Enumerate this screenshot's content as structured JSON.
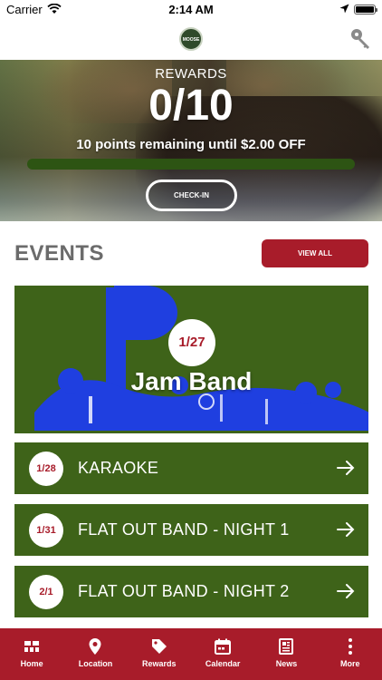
{
  "status_bar": {
    "carrier": "Carrier",
    "time": "2:14 AM"
  },
  "header": {
    "logo_text": "MOOSE",
    "key_icon": "key-icon"
  },
  "rewards": {
    "label": "REWARDS",
    "count": "0/10",
    "remaining_text": "10 points remaining until $2.00 OFF",
    "progress_fraction": 0.0,
    "checkin_label": "CHECK-IN"
  },
  "events": {
    "title": "EVENTS",
    "view_all_label": "VIEW ALL",
    "featured": {
      "date": "1/27",
      "title": "Jam Band"
    },
    "items": [
      {
        "date": "1/28",
        "title": "KARAOKE"
      },
      {
        "date": "1/31",
        "title": "FLAT OUT BAND - NIGHT 1"
      },
      {
        "date": "2/1",
        "title": "FLAT OUT BAND - NIGHT 2"
      }
    ]
  },
  "tab_bar": {
    "tabs": [
      {
        "label": "Home",
        "icon": "grid-icon"
      },
      {
        "label": "Location",
        "icon": "map-pin-icon"
      },
      {
        "label": "Rewards",
        "icon": "tag-icon"
      },
      {
        "label": "Calendar",
        "icon": "calendar-icon"
      },
      {
        "label": "News",
        "icon": "newspaper-icon"
      },
      {
        "label": "More",
        "icon": "more-dots-icon"
      }
    ]
  },
  "colors": {
    "brand_red": "#a81c2a",
    "event_green": "#3e6319",
    "note_blue": "#1f3fe0"
  }
}
